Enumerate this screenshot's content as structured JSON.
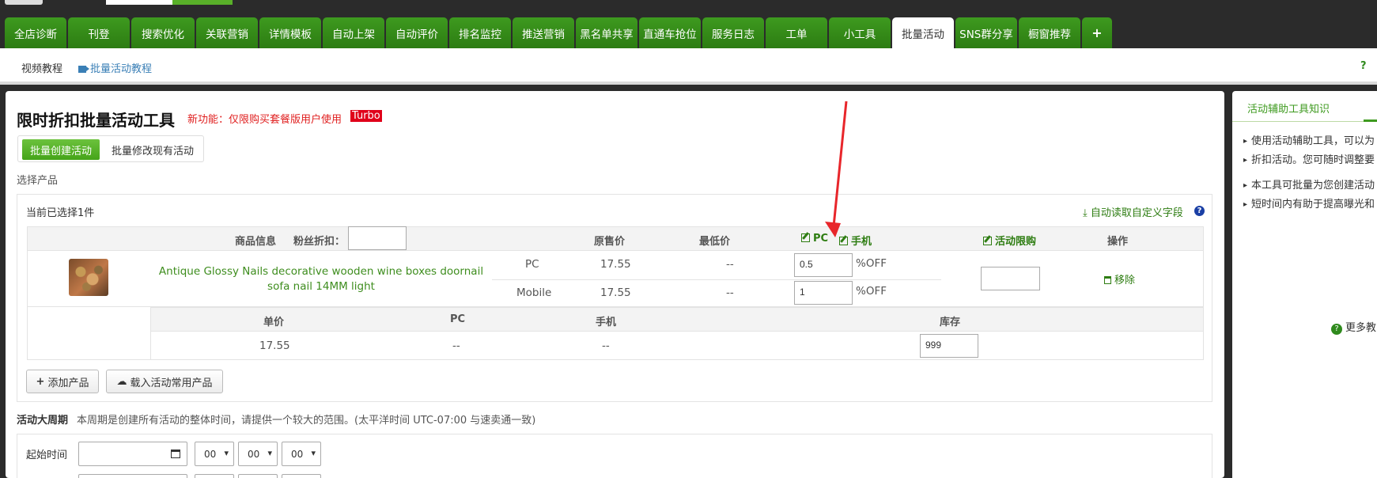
{
  "tabs": [
    {
      "label": "全店诊断",
      "active": false
    },
    {
      "label": "刊登",
      "active": false
    },
    {
      "label": "搜索优化",
      "active": false
    },
    {
      "label": "关联营销",
      "active": false
    },
    {
      "label": "详情模板",
      "active": false
    },
    {
      "label": "自动上架",
      "active": false
    },
    {
      "label": "自动评价",
      "active": false
    },
    {
      "label": "排名监控",
      "active": false
    },
    {
      "label": "推送营销",
      "active": false
    },
    {
      "label": "黑名单共享",
      "active": false
    },
    {
      "label": "直通车抢位",
      "active": false
    },
    {
      "label": "服务日志",
      "active": false
    },
    {
      "label": "工单",
      "active": false
    },
    {
      "label": "小工具",
      "active": false
    },
    {
      "label": "批量活动",
      "active": true
    },
    {
      "label": "SNS群分享",
      "active": false
    },
    {
      "label": "橱窗推荐",
      "active": false
    },
    {
      "label": "+",
      "active": false
    }
  ],
  "subnav": {
    "video_tutorial": "视频教程",
    "batch_tutorial": "批量活动教程",
    "help_icon": "?"
  },
  "page": {
    "title": "限时折扣批量活动工具",
    "new_feature": "新功能：仅限购买套餐版用户使用",
    "turbo": "Turbo",
    "btn_create": "批量创建活动",
    "btn_modify": "批量修改现有活动",
    "select_product": "选择产品"
  },
  "product_box": {
    "selected_count": "当前已选择1件",
    "auto_read": "自动读取自定义字段",
    "help": "?",
    "headers": {
      "product_info": "商品信息",
      "fans_discount": "粉丝折扣：",
      "original_price": "原售价",
      "lowest_price": "最低价",
      "pc": "PC",
      "mobile": "手机",
      "limit": "活动限购",
      "action": "操作"
    },
    "product": {
      "name": "Antique Glossy Nails decorative wooden wine boxes doornail sofa nail 14MM light",
      "rows": [
        {
          "platform": "PC",
          "price": "17.55",
          "lowest": "--",
          "discount": "0.5",
          "unit": "%OFF"
        },
        {
          "platform": "Mobile",
          "price": "17.55",
          "lowest": "--",
          "discount": "1",
          "unit": "%OFF"
        }
      ],
      "remove": "移除"
    },
    "sku_headers": {
      "unit_price": "单价",
      "pc": "PC",
      "mobile": "手机",
      "stock": "库存"
    },
    "sku_row": {
      "unit_price": "17.55",
      "pc": "--",
      "mobile": "--",
      "stock": "999"
    },
    "add_product": "添加产品",
    "load_common": "载入活动常用产品"
  },
  "period": {
    "title": "活动大周期",
    "desc": "本周期是创建所有活动的整体时间，请提供一个较大的范围。(太平洋时间 UTC-07:00 与速卖通一致)",
    "start_label": "起始时间",
    "hour": "00",
    "minute": "00",
    "second": "00"
  },
  "side": {
    "head": "活动辅助工具知识",
    "p1a": "使用活动辅助工具，可以为",
    "p1b": "折扣活动。您可随时调整要",
    "p2a": "本工具可批量为您创建活动",
    "p2b": "短时间内有助于提高曝光和",
    "more": "更多教"
  },
  "colors": {
    "tab_green": "#3e9a1f",
    "accent_green": "#2e7d12",
    "alert_red": "#e02020"
  }
}
